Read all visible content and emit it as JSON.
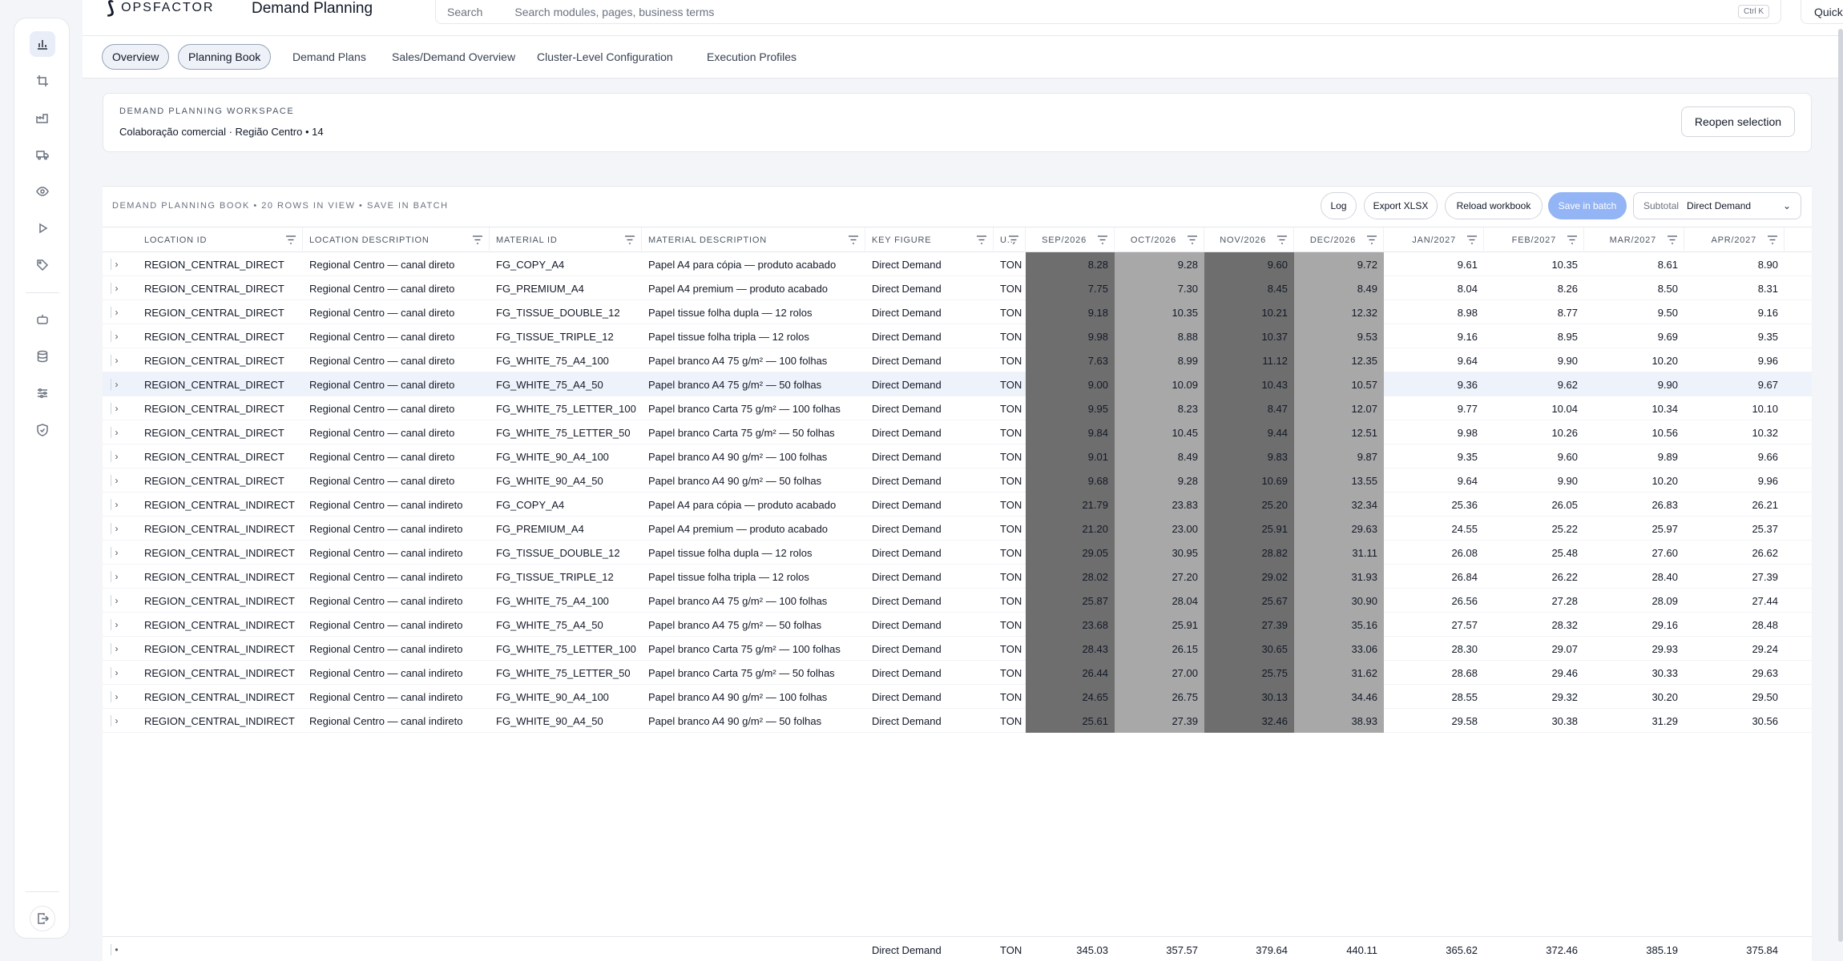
{
  "app": {
    "brand": "OPSFACTOR",
    "title": "Demand Planning",
    "search_label": "Search",
    "search_placeholder": "Search modules, pages, business terms",
    "search_shortcut": "Ctrl K",
    "quick_actions": "Quick actions"
  },
  "sidebar": {
    "icons": [
      "chart-bar-icon",
      "crop-icon",
      "factory-icon",
      "truck-icon",
      "eye-icon",
      "play-icon",
      "tag-icon",
      "robot-icon",
      "database-icon",
      "sliders-icon",
      "shield-icon",
      "logout-icon"
    ]
  },
  "tabs": [
    {
      "label": "Overview",
      "pill": true
    },
    {
      "label": "Planning Book",
      "pill": true
    },
    {
      "label": "Demand Plans",
      "pill": false
    },
    {
      "label": "Sales/Demand Overview",
      "pill": false
    },
    {
      "label": "Cluster-Level Configuration",
      "pill": false
    },
    {
      "label": "Execution Profiles",
      "pill": false
    }
  ],
  "workspace": {
    "kicker": "DEMAND PLANNING WORKSPACE",
    "subtitle": "Colaboração comercial · Região Centro  •  14",
    "reopen_label": "Reopen selection"
  },
  "book": {
    "heading": "DEMAND PLANNING BOOK  •  20 ROWS IN VIEW  •  SAVE IN BATCH",
    "log_label": "Log",
    "export_label": "Export XLSX",
    "reload_label": "Reload workbook",
    "save_label": "Save in batch",
    "subtotal_label": "Subtotal",
    "subtotal_value": "Direct Demand"
  },
  "columns": [
    "LOCATION ID",
    "LOCATION DESCRIPTION",
    "MATERIAL ID",
    "MATERIAL DESCRIPTION",
    "KEY FIGURE",
    "U...",
    "SEP/2026",
    "OCT/2026",
    "NOV/2026",
    "DEC/2026",
    "JAN/2027",
    "FEB/2027",
    "MAR/2027",
    "APR/2027"
  ],
  "rows": [
    [
      "REGION_CENTRAL_DIRECT",
      "Regional Centro — canal direto",
      "FG_COPY_A4",
      "Papel A4 para cópia — produto acabado",
      "Direct Demand",
      "TON",
      "8.28",
      "9.28",
      "9.60",
      "9.72",
      "9.61",
      "10.35",
      "8.61",
      "8.90"
    ],
    [
      "REGION_CENTRAL_DIRECT",
      "Regional Centro — canal direto",
      "FG_PREMIUM_A4",
      "Papel A4 premium — produto acabado",
      "Direct Demand",
      "TON",
      "7.75",
      "7.30",
      "8.45",
      "8.49",
      "8.04",
      "8.26",
      "8.50",
      "8.31"
    ],
    [
      "REGION_CENTRAL_DIRECT",
      "Regional Centro — canal direto",
      "FG_TISSUE_DOUBLE_12",
      "Papel tissue folha dupla — 12 rolos",
      "Direct Demand",
      "TON",
      "9.18",
      "10.35",
      "10.21",
      "12.32",
      "8.98",
      "8.77",
      "9.50",
      "9.16"
    ],
    [
      "REGION_CENTRAL_DIRECT",
      "Regional Centro — canal direto",
      "FG_TISSUE_TRIPLE_12",
      "Papel tissue folha tripla — 12 rolos",
      "Direct Demand",
      "TON",
      "9.98",
      "8.88",
      "10.37",
      "9.53",
      "9.16",
      "8.95",
      "9.69",
      "9.35"
    ],
    [
      "REGION_CENTRAL_DIRECT",
      "Regional Centro — canal direto",
      "FG_WHITE_75_A4_100",
      "Papel branco A4 75 g/m² — 100 folhas",
      "Direct Demand",
      "TON",
      "7.63",
      "8.99",
      "11.12",
      "12.35",
      "9.64",
      "9.90",
      "10.20",
      "9.96"
    ],
    [
      "REGION_CENTRAL_DIRECT",
      "Regional Centro — canal direto",
      "FG_WHITE_75_A4_50",
      "Papel branco A4 75 g/m² — 50 folhas",
      "Direct Demand",
      "TON",
      "9.00",
      "10.09",
      "10.43",
      "10.57",
      "9.36",
      "9.62",
      "9.90",
      "9.67"
    ],
    [
      "REGION_CENTRAL_DIRECT",
      "Regional Centro — canal direto",
      "FG_WHITE_75_LETTER_100",
      "Papel branco Carta 75 g/m² — 100 folhas",
      "Direct Demand",
      "TON",
      "9.95",
      "8.23",
      "8.47",
      "12.07",
      "9.77",
      "10.04",
      "10.34",
      "10.10"
    ],
    [
      "REGION_CENTRAL_DIRECT",
      "Regional Centro — canal direto",
      "FG_WHITE_75_LETTER_50",
      "Papel branco Carta 75 g/m² — 50 folhas",
      "Direct Demand",
      "TON",
      "9.84",
      "10.45",
      "9.44",
      "12.51",
      "9.98",
      "10.26",
      "10.56",
      "10.32"
    ],
    [
      "REGION_CENTRAL_DIRECT",
      "Regional Centro — canal direto",
      "FG_WHITE_90_A4_100",
      "Papel branco A4 90 g/m² — 100 folhas",
      "Direct Demand",
      "TON",
      "9.01",
      "8.49",
      "9.83",
      "9.87",
      "9.35",
      "9.60",
      "9.89",
      "9.66"
    ],
    [
      "REGION_CENTRAL_DIRECT",
      "Regional Centro — canal direto",
      "FG_WHITE_90_A4_50",
      "Papel branco A4 90 g/m² — 50 folhas",
      "Direct Demand",
      "TON",
      "9.68",
      "9.28",
      "10.69",
      "13.55",
      "9.64",
      "9.90",
      "10.20",
      "9.96"
    ],
    [
      "REGION_CENTRAL_INDIRECT",
      "Regional Centro — canal indireto",
      "FG_COPY_A4",
      "Papel A4 para cópia — produto acabado",
      "Direct Demand",
      "TON",
      "21.79",
      "23.83",
      "25.20",
      "32.34",
      "25.36",
      "26.05",
      "26.83",
      "26.21"
    ],
    [
      "REGION_CENTRAL_INDIRECT",
      "Regional Centro — canal indireto",
      "FG_PREMIUM_A4",
      "Papel A4 premium — produto acabado",
      "Direct Demand",
      "TON",
      "21.20",
      "23.00",
      "25.91",
      "29.63",
      "24.55",
      "25.22",
      "25.97",
      "25.37"
    ],
    [
      "REGION_CENTRAL_INDIRECT",
      "Regional Centro — canal indireto",
      "FG_TISSUE_DOUBLE_12",
      "Papel tissue folha dupla — 12 rolos",
      "Direct Demand",
      "TON",
      "29.05",
      "30.95",
      "28.82",
      "31.11",
      "26.08",
      "25.48",
      "27.60",
      "26.62"
    ],
    [
      "REGION_CENTRAL_INDIRECT",
      "Regional Centro — canal indireto",
      "FG_TISSUE_TRIPLE_12",
      "Papel tissue folha tripla — 12 rolos",
      "Direct Demand",
      "TON",
      "28.02",
      "27.20",
      "29.02",
      "31.93",
      "26.84",
      "26.22",
      "28.40",
      "27.39"
    ],
    [
      "REGION_CENTRAL_INDIRECT",
      "Regional Centro — canal indireto",
      "FG_WHITE_75_A4_100",
      "Papel branco A4 75 g/m² — 100 folhas",
      "Direct Demand",
      "TON",
      "25.87",
      "28.04",
      "25.67",
      "30.90",
      "26.56",
      "27.28",
      "28.09",
      "27.44"
    ],
    [
      "REGION_CENTRAL_INDIRECT",
      "Regional Centro — canal indireto",
      "FG_WHITE_75_A4_50",
      "Papel branco A4 75 g/m² — 50 folhas",
      "Direct Demand",
      "TON",
      "23.68",
      "25.91",
      "27.39",
      "35.16",
      "27.57",
      "28.32",
      "29.16",
      "28.48"
    ],
    [
      "REGION_CENTRAL_INDIRECT",
      "Regional Centro — canal indireto",
      "FG_WHITE_75_LETTER_100",
      "Papel branco Carta 75 g/m² — 100 folhas",
      "Direct Demand",
      "TON",
      "28.43",
      "26.15",
      "30.65",
      "33.06",
      "28.30",
      "29.07",
      "29.93",
      "29.24"
    ],
    [
      "REGION_CENTRAL_INDIRECT",
      "Regional Centro — canal indireto",
      "FG_WHITE_75_LETTER_50",
      "Papel branco Carta 75 g/m² — 50 folhas",
      "Direct Demand",
      "TON",
      "26.44",
      "27.00",
      "25.75",
      "31.62",
      "28.68",
      "29.46",
      "30.33",
      "29.63"
    ],
    [
      "REGION_CENTRAL_INDIRECT",
      "Regional Centro — canal indireto",
      "FG_WHITE_90_A4_100",
      "Papel branco A4 90 g/m² — 100 folhas",
      "Direct Demand",
      "TON",
      "24.65",
      "26.75",
      "30.13",
      "34.46",
      "28.55",
      "29.32",
      "30.20",
      "29.50"
    ],
    [
      "REGION_CENTRAL_INDIRECT",
      "Regional Centro — canal indireto",
      "FG_WHITE_90_A4_50",
      "Papel branco A4 90 g/m² — 50 folhas",
      "Direct Demand",
      "TON",
      "25.61",
      "27.39",
      "32.46",
      "38.93",
      "29.58",
      "30.38",
      "31.29",
      "30.56"
    ]
  ],
  "highlight_row": 5,
  "shaded_colors": [
    "#6e6e6e",
    "#a8a8a8"
  ],
  "footer": [
    "Direct Demand",
    "TON",
    "345.03",
    "357.57",
    "379.64",
    "440.11",
    "365.62",
    "372.46",
    "385.19",
    "375.84"
  ]
}
